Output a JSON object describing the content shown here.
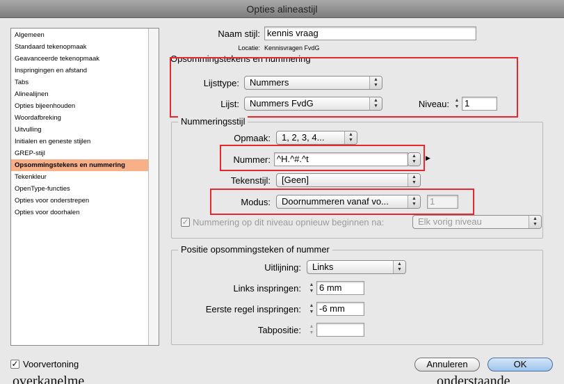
{
  "window": {
    "title": "Opties alineastijl"
  },
  "sidebar": {
    "items": [
      {
        "label": "Algemeen"
      },
      {
        "label": "Standaard tekenopmaak"
      },
      {
        "label": "Geavanceerde tekenopmaak"
      },
      {
        "label": "Inspringingen en afstand"
      },
      {
        "label": "Tabs"
      },
      {
        "label": "Alinealijnen"
      },
      {
        "label": "Opties bijeenhouden"
      },
      {
        "label": "Woordafbreking"
      },
      {
        "label": "Uitvulling"
      },
      {
        "label": "Initialen en geneste stijlen"
      },
      {
        "label": "GREP-stijl"
      },
      {
        "label": "Opsommingstekens en nummering"
      },
      {
        "label": "Tekenkleur"
      },
      {
        "label": "OpenType-functies"
      },
      {
        "label": "Opties voor onderstrepen"
      },
      {
        "label": "Opties voor doorhalen"
      }
    ],
    "selected_index": 11
  },
  "header": {
    "style_name_label": "Naam stijl:",
    "style_name_value": "kennis vraag",
    "location_label": "Locatie:",
    "location_value": "Kennisvragen FvdG"
  },
  "bullets_numbering": {
    "title": "Opsommingstekens en nummering",
    "list_type_label": "Lijsttype:",
    "list_type_value": "Nummers",
    "list_label": "Lijst:",
    "list_value": "Nummers FvdG",
    "level_label": "Niveau:",
    "level_value": "1"
  },
  "numbering_style": {
    "title": "Nummeringsstijl",
    "format_label": "Opmaak:",
    "format_value": "1, 2, 3, 4...",
    "number_label": "Nummer:",
    "number_value": "^H.^#.^t",
    "char_style_label": "Tekenstijl:",
    "char_style_value": "[Geen]",
    "mode_label": "Modus:",
    "mode_value": "Doornummeren vanaf vo...",
    "mode_start_value": "1",
    "restart_label": "Nummering op dit niveau opnieuw beginnen na:",
    "restart_checked": true,
    "restart_value": "Elk vorig niveau"
  },
  "position": {
    "title": "Positie opsommingsteken of nummer",
    "alignment_label": "Uitlijning:",
    "alignment_value": "Links",
    "left_indent_label": "Links inspringen:",
    "left_indent_value": "6 mm",
    "first_line_label": "Eerste regel inspringen:",
    "first_line_value": "-6 mm",
    "tab_position_label": "Tabpositie:",
    "tab_position_value": ""
  },
  "footer": {
    "preview_label": "Voorvertoning",
    "preview_checked": true,
    "cancel_label": "Annuleren",
    "ok_label": "OK"
  },
  "background": {
    "text_left": "overkanelme",
    "text_right": "onderstaande"
  },
  "colors": {
    "selection": "#f8b088",
    "highlight_box": "#e8262c",
    "default_button": "#9cc3ec"
  }
}
